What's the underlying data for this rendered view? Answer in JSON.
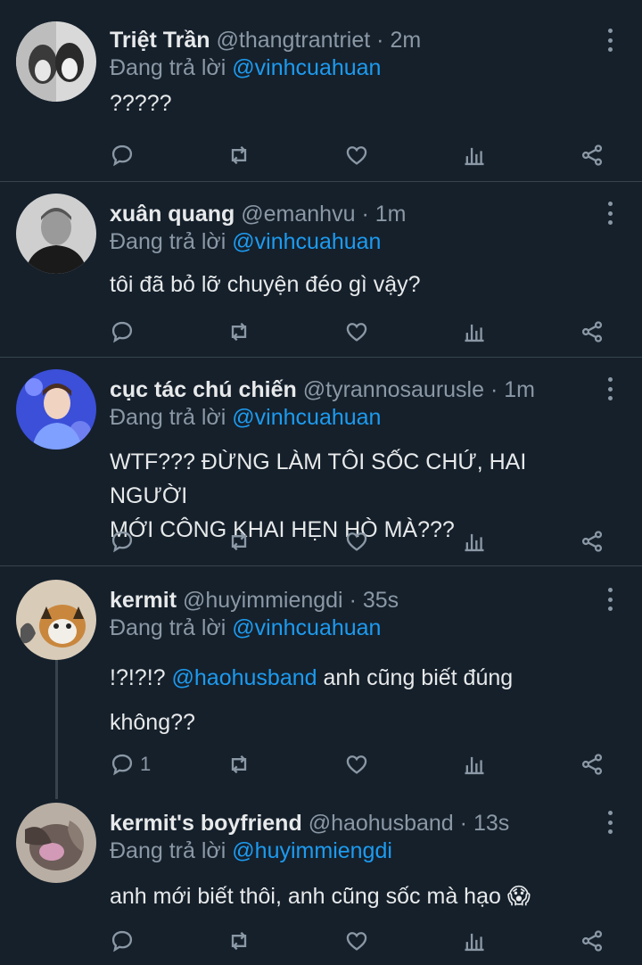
{
  "tweets": [
    {
      "name": "Triệt Trần",
      "handle": "@thangtrantriet",
      "time": "2m",
      "reply_prefix": "Đang trả lời",
      "reply_to": "@vinhcuahuan",
      "text_lines": [
        "?????"
      ],
      "reply_count": ""
    },
    {
      "name": "xuân quang",
      "handle": "@emanhvu",
      "time": "1m",
      "reply_prefix": "Đang trả lời",
      "reply_to": "@vinhcuahuan",
      "text_lines": [
        "tôi đã bỏ lỡ chuyện đéo gì vậy?"
      ],
      "reply_count": ""
    },
    {
      "name": "cục tác chú chiến",
      "handle": "@tyrannosaurusle",
      "time": "1m",
      "reply_prefix": "Đang trả lời",
      "reply_to": "@vinhcuahuan",
      "text_lines": [
        "WTF??? ĐỪNG LÀM TÔI SỐC CHỨ, HAI NGƯỜI",
        "MỚI CÔNG KHAI HẸN HÒ MÀ???"
      ],
      "reply_count": ""
    },
    {
      "name": "kermit",
      "handle": "@huyimmiengdi",
      "time": "35s",
      "reply_prefix": "Đang trả lời",
      "reply_to": "@vinhcuahuan",
      "text_prefix": "!?!?!?",
      "text_mention": "@haohusband",
      "text_rest": "anh cũng biết đúng",
      "text_line2": "không??",
      "reply_count": "1"
    },
    {
      "name": "kermit's boyfriend",
      "handle": "@haohusband",
      "time": "13s",
      "reply_prefix": "Đang trả lời",
      "reply_to": "@huyimmiengdi",
      "text_lines": [
        "anh mới biết thôi, anh cũng sốc mà hạo"
      ],
      "emoji": "😱",
      "reply_count": ""
    }
  ],
  "separator": "·",
  "icons": [
    "reply-icon",
    "retweet-icon",
    "like-icon",
    "analytics-icon",
    "share-icon",
    "more-icon"
  ],
  "colors": {
    "background": "#15202b",
    "muted": "#8b98a5",
    "accent": "#1d9bf0",
    "divider": "#38444d"
  }
}
